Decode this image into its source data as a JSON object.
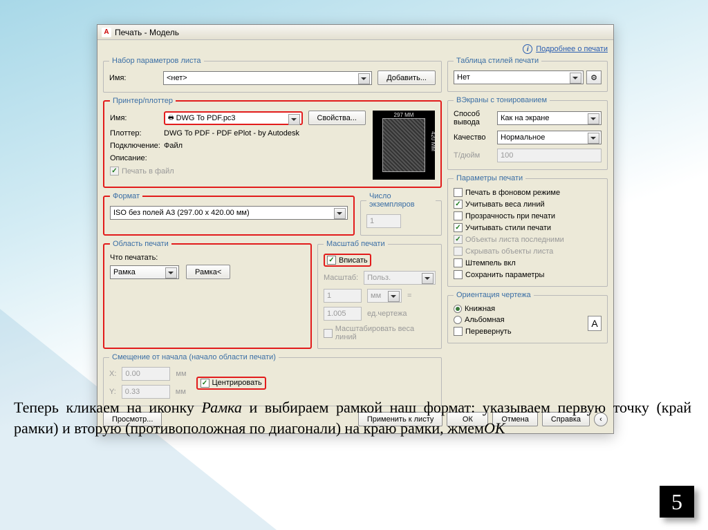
{
  "title": "Печать - Модель",
  "top_link": "Подробнее о печати",
  "page_setup": {
    "legend": "Набор параметров листа",
    "name_label": "Имя:",
    "name_value": "<нет>",
    "add_btn": "Добавить..."
  },
  "printer": {
    "legend": "Принтер/плоттер",
    "name_label": "Имя:",
    "name_value": "DWG To PDF.pc3",
    "props_btn": "Свойства...",
    "plotter_label": "Плоттер:",
    "plotter_value": "DWG To PDF - PDF ePlot - by Autodesk",
    "conn_label": "Подключение:",
    "conn_value": "Файл",
    "desc_label": "Описание:",
    "to_file": "Печать в файл",
    "preview_w": "297 MM",
    "preview_h": "420 MM"
  },
  "paper": {
    "legend": "Формат",
    "value": "ISO без полей A3 (297.00 x 420.00 мм)"
  },
  "copies": {
    "legend": "Число экземпляров",
    "value": "1"
  },
  "area": {
    "legend": "Область печати",
    "what_label": "Что печатать:",
    "what_value": "Рамка",
    "window_btn": "Рамка<"
  },
  "scale": {
    "legend": "Масштаб печати",
    "fit": "Вписать",
    "label": "Масштаб:",
    "value": "Польз.",
    "num": "1",
    "unit": "мм",
    "den": "1.005",
    "den_unit": "ед.чертежа",
    "lw": "Масштабировать веса линий"
  },
  "offset": {
    "legend": "Смещение от начала (начало области печати)",
    "x_label": "X:",
    "x_value": "0.00",
    "y_label": "Y:",
    "y_value": "0.33",
    "unit": "мм",
    "center": "Центрировать"
  },
  "styles": {
    "legend": "Таблица стилей печати",
    "value": "Нет"
  },
  "shade": {
    "legend": "ВЭкраны с тонированием",
    "mode_label": "Способ вывода",
    "mode_value": "Как на экране",
    "qual_label": "Качество",
    "qual_value": "Нормальное",
    "dpi_label": "Т/дюйм",
    "dpi_value": "100"
  },
  "options": {
    "legend": "Параметры печати",
    "bg": "Печать в фоновом режиме",
    "lw": "Учитывать веса линий",
    "trans": "Прозрачность при печати",
    "styles": "Учитывать стили печати",
    "last": "Объекты листа последними",
    "hide": "Скрывать объекты листа",
    "stamp": "Штемпель вкл",
    "save": "Сохранить параметры"
  },
  "orient": {
    "legend": "Ориентация чертежа",
    "portrait": "Книжная",
    "landscape": "Альбомная",
    "upside": "Перевернуть"
  },
  "buttons": {
    "preview": "Просмотр...",
    "apply": "Применить к листу",
    "ok": "ОК",
    "cancel": "Отмена",
    "help": "Справка"
  },
  "caption_parts": {
    "p1": "Теперь кликаем на иконку ",
    "ramka": "Рамка ",
    "p2": "и выбираем рамкой наш формат: указываем первую точку (край рамки) и вторую (противоположная по диагонали) на краю рамки, жмем",
    "ok": "ОК"
  },
  "pagenum": "5"
}
